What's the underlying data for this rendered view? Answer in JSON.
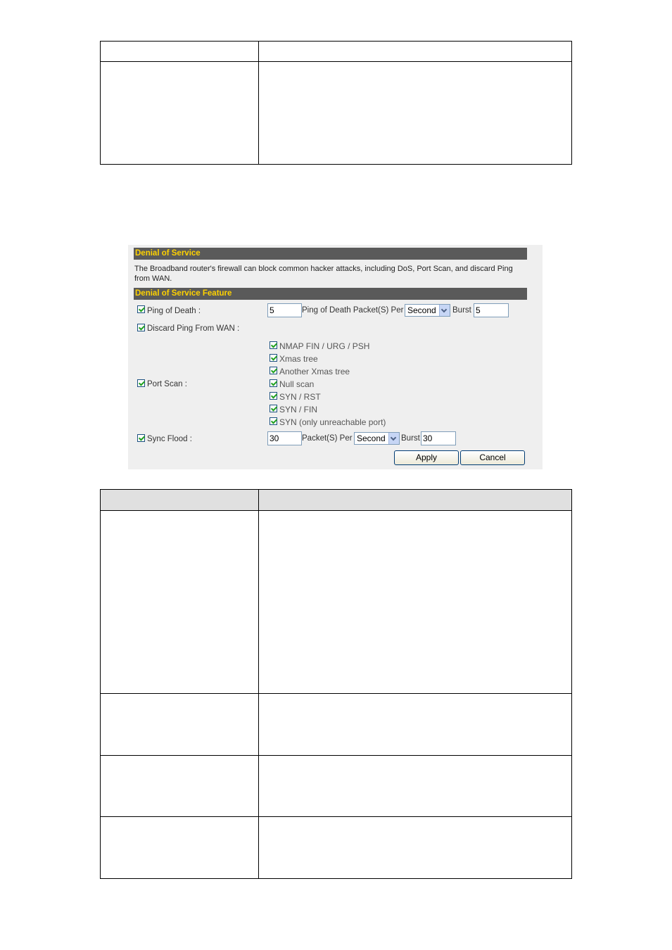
{
  "panel": {
    "section_title": "Denial of Service",
    "description": "The Broadband router's firewall can block common hacker attacks, including DoS, Port Scan, and discard Ping from WAN.",
    "feature_title": "Denial of Service Feature",
    "ping_of_death": {
      "label": "Ping of Death :",
      "checked": true,
      "packets_value": "5",
      "packets_text": "Ping of Death Packet(S) Per",
      "unit_selected": "Second",
      "burst_label": "Burst",
      "burst_value": "5"
    },
    "discard_ping": {
      "label": "Discard Ping From WAN :",
      "checked": true
    },
    "port_scan": {
      "label": "Port Scan :",
      "checked": true,
      "options": [
        "NMAP FIN / URG / PSH",
        "Xmas tree",
        "Another Xmas tree",
        "Null scan",
        "SYN / RST",
        "SYN / FIN",
        "SYN (only unreachable port)"
      ]
    },
    "sync_flood": {
      "label": "Sync Flood :",
      "checked": true,
      "packets_value": "30",
      "packets_text": "Packet(S) Per",
      "unit_selected": "Second",
      "burst_label": "Burst",
      "burst_value": "30"
    },
    "apply_label": "Apply",
    "cancel_label": "Cancel"
  },
  "colors": {
    "bar_background": "#5a5a5a",
    "bar_text": "#ffd200",
    "panel_background": "#efefef",
    "checkmark": "#21a121"
  }
}
